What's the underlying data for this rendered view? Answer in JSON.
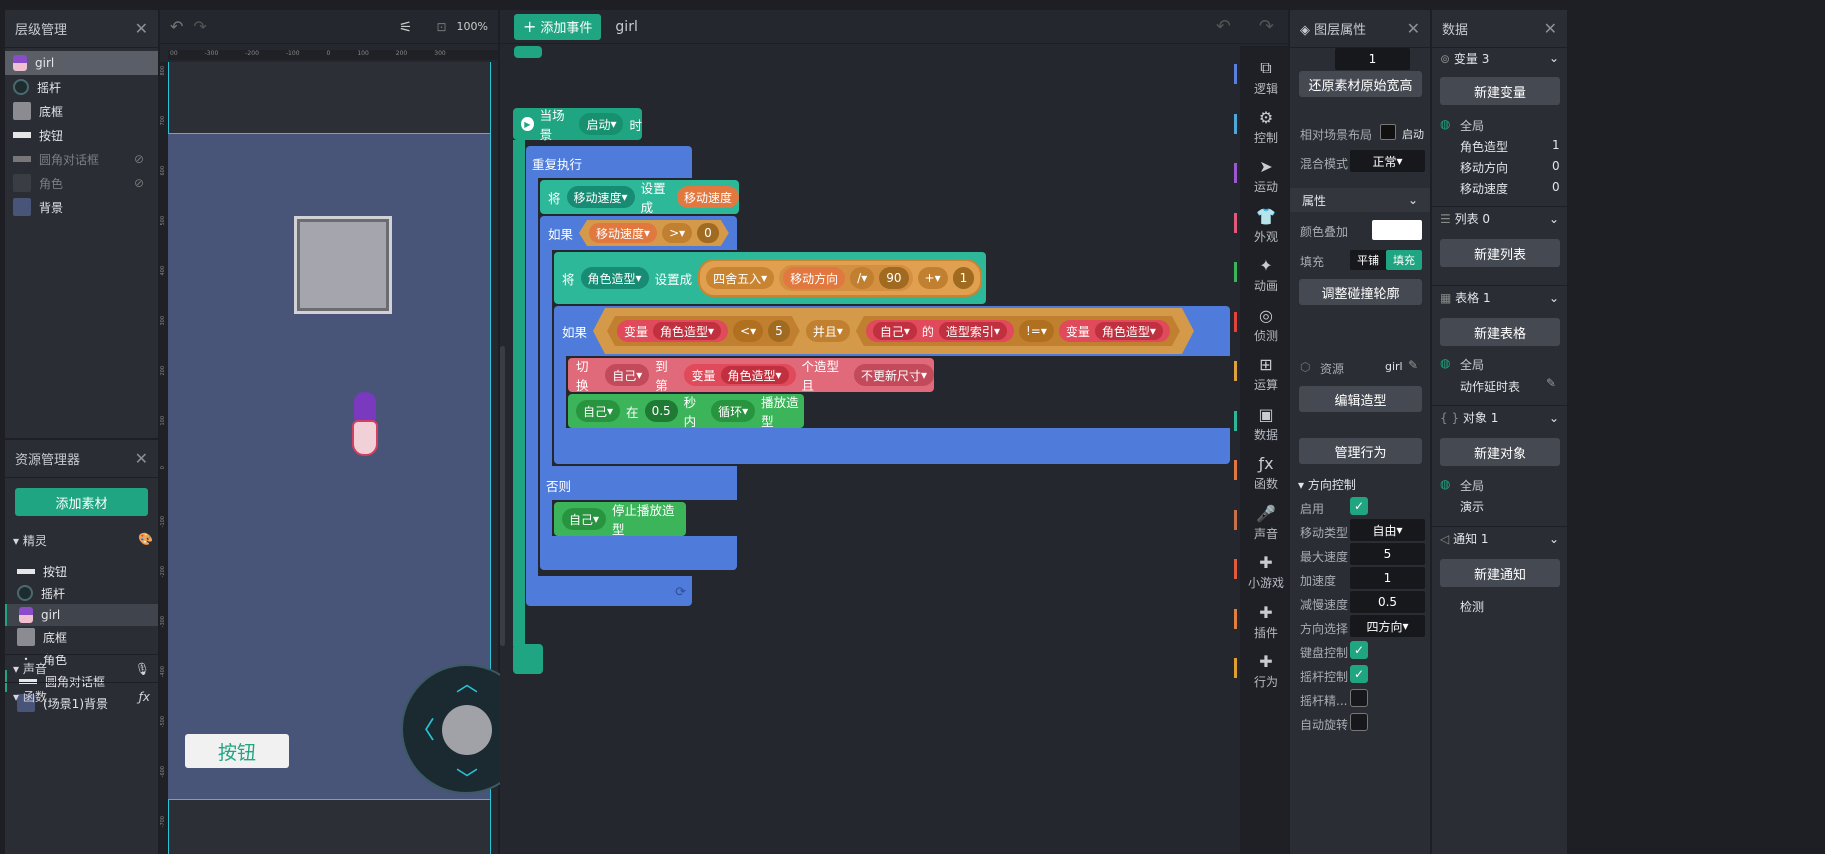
{
  "layer_panel": {
    "title": "层级管理",
    "items": [
      "girl",
      "摇杆",
      "底框",
      "按钮",
      "圆角对话框",
      "角色",
      "背景"
    ]
  },
  "toolbar": {
    "zoom": "100%"
  },
  "ruler_ticks": [
    "00",
    "-300",
    "-200",
    "-100",
    "0",
    "100",
    "200",
    "300"
  ],
  "vruler_ticks": [
    "800",
    "700",
    "600",
    "500",
    "400",
    "300",
    "200",
    "100",
    "0",
    "-100",
    "-200",
    "-300",
    "-400",
    "-500",
    "-600",
    "-700"
  ],
  "asset_panel": {
    "title": "资源管理器",
    "add_btn": "添加素材",
    "sprites_label": "精灵",
    "sprites": [
      "按钮",
      "摇杆",
      "girl",
      "底框",
      "角色",
      "圆角对话框",
      "(场景1)背景"
    ],
    "sound_label": "声音",
    "func_label": "函数"
  },
  "stage": {
    "button_label": "按钮"
  },
  "editor": {
    "add_event": "添加事件",
    "sprite_name": "girl"
  },
  "blocks": {
    "when": "当场景",
    "when_dd": "启动",
    "when_tail": "时",
    "forever": "重复执行",
    "set1_a": "将",
    "set1_var": "移动速度",
    "set1_b": "设置成",
    "set1_val": "移动速度",
    "if1": "如果",
    "if1_var": "移动速度",
    "if1_op": ">",
    "if1_num": "0",
    "set2_a": "将",
    "set2_var": "角色造型",
    "set2_b": "设置成",
    "set2_round": "四舍五入",
    "set2_dir": "移动方向",
    "set2_div": "/",
    "set2_n90": "90",
    "set2_plus": "+",
    "set2_n1": "1",
    "if2": "如果",
    "if2_varlbl": "变量",
    "if2_var": "角色造型",
    "if2_lt": "<",
    "if2_n5": "5",
    "if2_and": "并且",
    "if2_self": "自己",
    "if2_of": "的",
    "if2_idx": "造型索引",
    "if2_ne": "!=",
    "if2_varlbl2": "变量",
    "if2_var2": "角色造型",
    "switch_a": "切换",
    "switch_self": "自己",
    "switch_to": "到第",
    "switch_varlbl": "变量",
    "switch_var": "角色造型",
    "switch_b": "个造型且",
    "switch_size": "不更新尺寸",
    "play_self": "自己",
    "play_in": "在",
    "play_sec": "0.5",
    "play_within": "秒内",
    "play_loop": "循环",
    "play_act": "播放造型",
    "else": "否则",
    "stop_self": "自己",
    "stop_act": "停止播放造型"
  },
  "categories": [
    {
      "label": "逻辑",
      "icon": "⧉",
      "color": "#5b7fdc"
    },
    {
      "label": "控制",
      "icon": "⚙",
      "color": "#4fa8d8"
    },
    {
      "label": "运动",
      "icon": "➤",
      "color": "#9b59d0"
    },
    {
      "label": "外观",
      "icon": "👕",
      "color": "#e05a7a"
    },
    {
      "label": "动画",
      "icon": "✦",
      "color": "#3cb55a"
    },
    {
      "label": "侦测",
      "icon": "◎",
      "color": "#e0443c"
    },
    {
      "label": "运算",
      "icon": "⊞",
      "color": "#e0a040"
    },
    {
      "label": "数据",
      "icon": "▣",
      "color": "#2eb89a"
    },
    {
      "label": "函数",
      "icon": "ƒx",
      "color": "#e07840"
    },
    {
      "label": "声音",
      "icon": "🎤",
      "color": "#c8704a"
    },
    {
      "label": "小游戏",
      "icon": "✚",
      "color": "#e05a3c"
    },
    {
      "label": "插件",
      "icon": "✚",
      "color": "#e08040"
    },
    {
      "label": "行为",
      "icon": "✚",
      "color": "#e0a030"
    }
  ],
  "props": {
    "title": "图层属性",
    "top_val": "1",
    "restore_btn": "还原素材原始宽高",
    "relative_label": "相对场景布局",
    "relative_val": "启动",
    "blend_label": "混合模式",
    "blend_val": "正常",
    "attr_label": "属性",
    "color_label": "颜色叠加",
    "fill_label": "填充",
    "fill_opt1": "平铺",
    "fill_opt2": "填充",
    "collision_btn": "调整碰撞轮廓",
    "res_label": "资源",
    "res_val": "girl",
    "edit_costume": "编辑造型",
    "manage_behavior": "管理行为",
    "dir_title": "方向控制",
    "enable": "启用",
    "move_type": "移动类型",
    "move_type_val": "自由",
    "max_speed": "最大速度",
    "max_speed_val": "5",
    "accel": "加速度",
    "accel_val": "1",
    "decel": "减慢速度",
    "decel_val": "0.5",
    "dir_select": "方向选择",
    "dir_select_val": "四方向",
    "keyboard": "键盘控制",
    "joystick": "摇杆控制",
    "joystick_sens": "摇杆精...",
    "auto_rotate": "自动旋转"
  },
  "data_panel": {
    "title": "数据",
    "vars_label": "变量 3",
    "new_var": "新建变量",
    "global": "全局",
    "vars": [
      {
        "name": "角色造型",
        "val": "1"
      },
      {
        "name": "移动方向",
        "val": "0"
      },
      {
        "name": "移动速度",
        "val": "0"
      }
    ],
    "list_label": "列表 0",
    "new_list": "新建列表",
    "table_label": "表格 1",
    "new_table": "新建表格",
    "table_global": "全局",
    "table_item": "动作延时表",
    "obj_label": "对象 1",
    "new_obj": "新建对象",
    "obj_global": "全局",
    "obj_item": "演示",
    "notify_label": "通知 1",
    "new_notify": "新建通知",
    "notify_item": "检测"
  }
}
